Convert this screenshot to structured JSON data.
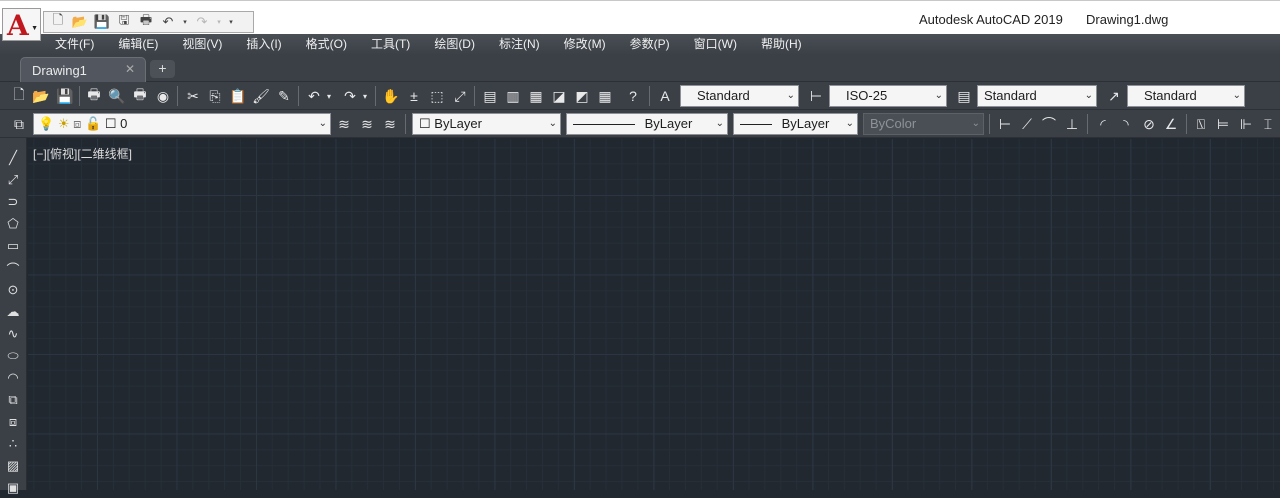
{
  "app": {
    "logo_letter": "A",
    "product": "Autodesk AutoCAD 2019",
    "document": "Drawing1.dwg"
  },
  "quick_access": [
    "new-icon",
    "open-icon",
    "save-icon",
    "save-as-icon",
    "print-icon",
    "undo-icon",
    "redo-icon",
    "customize-icon"
  ],
  "menu": [
    "文件(F)",
    "编辑(E)",
    "视图(V)",
    "插入(I)",
    "格式(O)",
    "工具(T)",
    "绘图(D)",
    "标注(N)",
    "修改(M)",
    "参数(P)",
    "窗口(W)",
    "帮助(H)"
  ],
  "tabs": {
    "active": "Drawing1",
    "close_glyph": "✕",
    "add_glyph": "+"
  },
  "styles_toolbar": {
    "text_style": "Standard",
    "dim_style": "ISO-25",
    "table_style": "Standard",
    "multileader_style": "Standard"
  },
  "layers_toolbar": {
    "current_layer": "0",
    "color": "ByLayer",
    "linetype": "ByLayer",
    "lineweight": "ByLayer",
    "plot_style": "ByColor"
  },
  "viewport_label": "[−][俯视][二维线框]",
  "colors": {
    "canvas_bg": "#212830",
    "toolbar_bg": "#3b4047",
    "logo_red": "#c1181f"
  }
}
